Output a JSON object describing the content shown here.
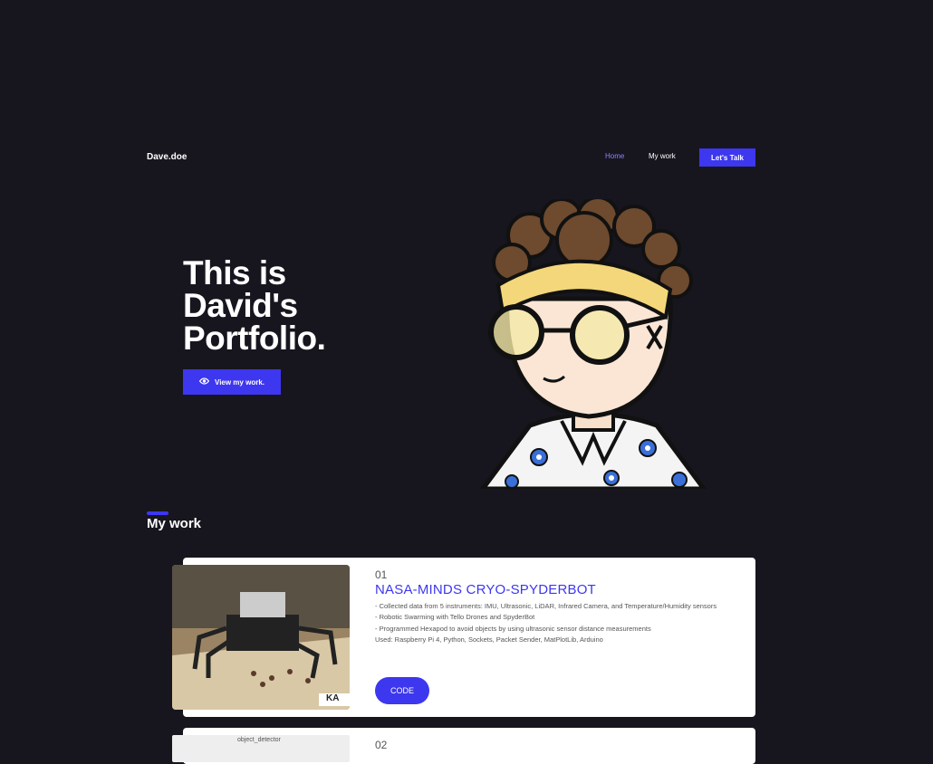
{
  "header": {
    "brand": "Dave.doe",
    "nav": {
      "home": "Home",
      "work": "My work",
      "talk": "Let's Talk"
    }
  },
  "hero": {
    "title_lines": [
      "This is",
      "David's",
      "Portfolio."
    ],
    "cta": "View my work."
  },
  "work": {
    "title": "My work",
    "projects": [
      {
        "number": "01",
        "title": "NASA-MINDS CRYO-SPYDERBOT",
        "lines": [
          "- Collected data from 5 instruments: IMU, Ultrasonic, LiDAR, Infrared Camera, and Temperature/Humidity sensors",
          "- Robotic Swarming with Tello Drones and SpyderBot",
          "- Programmed Hexapod to avoid objects by using ultrasonic sensor distance measurements",
          "Used: Raspberry Pi 4, Python, Sockets, Packet Sender, MatPlotLib, Arduino"
        ],
        "button": "CODE",
        "image_badge": "KA"
      },
      {
        "number": "02",
        "window_title": "object_detector"
      }
    ]
  }
}
